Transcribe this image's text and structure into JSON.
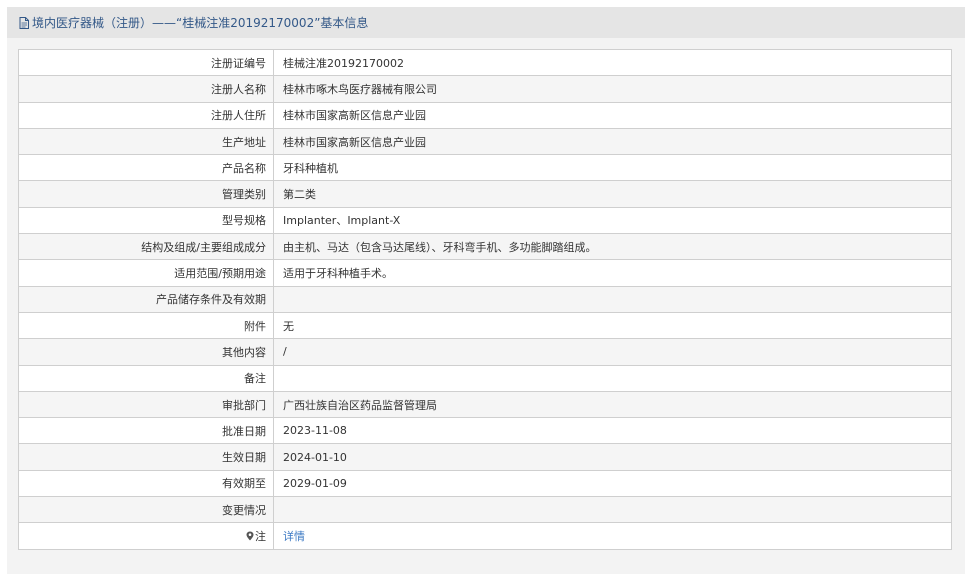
{
  "header": {
    "title": "境内医疗器械（注册）——“桂械注准20192170002”基本信息"
  },
  "rows": [
    {
      "label": "注册证编号",
      "value": "桂械注准20192170002"
    },
    {
      "label": "注册人名称",
      "value": "桂林市啄木鸟医疗器械有限公司"
    },
    {
      "label": "注册人住所",
      "value": "桂林市国家高新区信息产业园"
    },
    {
      "label": "生产地址",
      "value": "桂林市国家高新区信息产业园"
    },
    {
      "label": "产品名称",
      "value": "牙科种植机"
    },
    {
      "label": "管理类别",
      "value": "第二类"
    },
    {
      "label": "型号规格",
      "value": "Implanter、Implant-X"
    },
    {
      "label": "结构及组成/主要组成成分",
      "value": "由主机、马达（包含马达尾线）、牙科弯手机、多功能脚踏组成。"
    },
    {
      "label": "适用范围/预期用途",
      "value": "适用于牙科种植手术。"
    },
    {
      "label": "产品储存条件及有效期",
      "value": ""
    },
    {
      "label": "附件",
      "value": "无"
    },
    {
      "label": "其他内容",
      "value": "/"
    },
    {
      "label": "备注",
      "value": ""
    },
    {
      "label": "审批部门",
      "value": "广西壮族自治区药品监督管理局"
    },
    {
      "label": "批准日期",
      "value": "2023-11-08"
    },
    {
      "label": "生效日期",
      "value": "2024-01-10"
    },
    {
      "label": "有效期至",
      "value": "2029-01-09"
    },
    {
      "label": "变更情况",
      "value": ""
    }
  ],
  "note": {
    "label": "注",
    "link_text": "详情"
  }
}
